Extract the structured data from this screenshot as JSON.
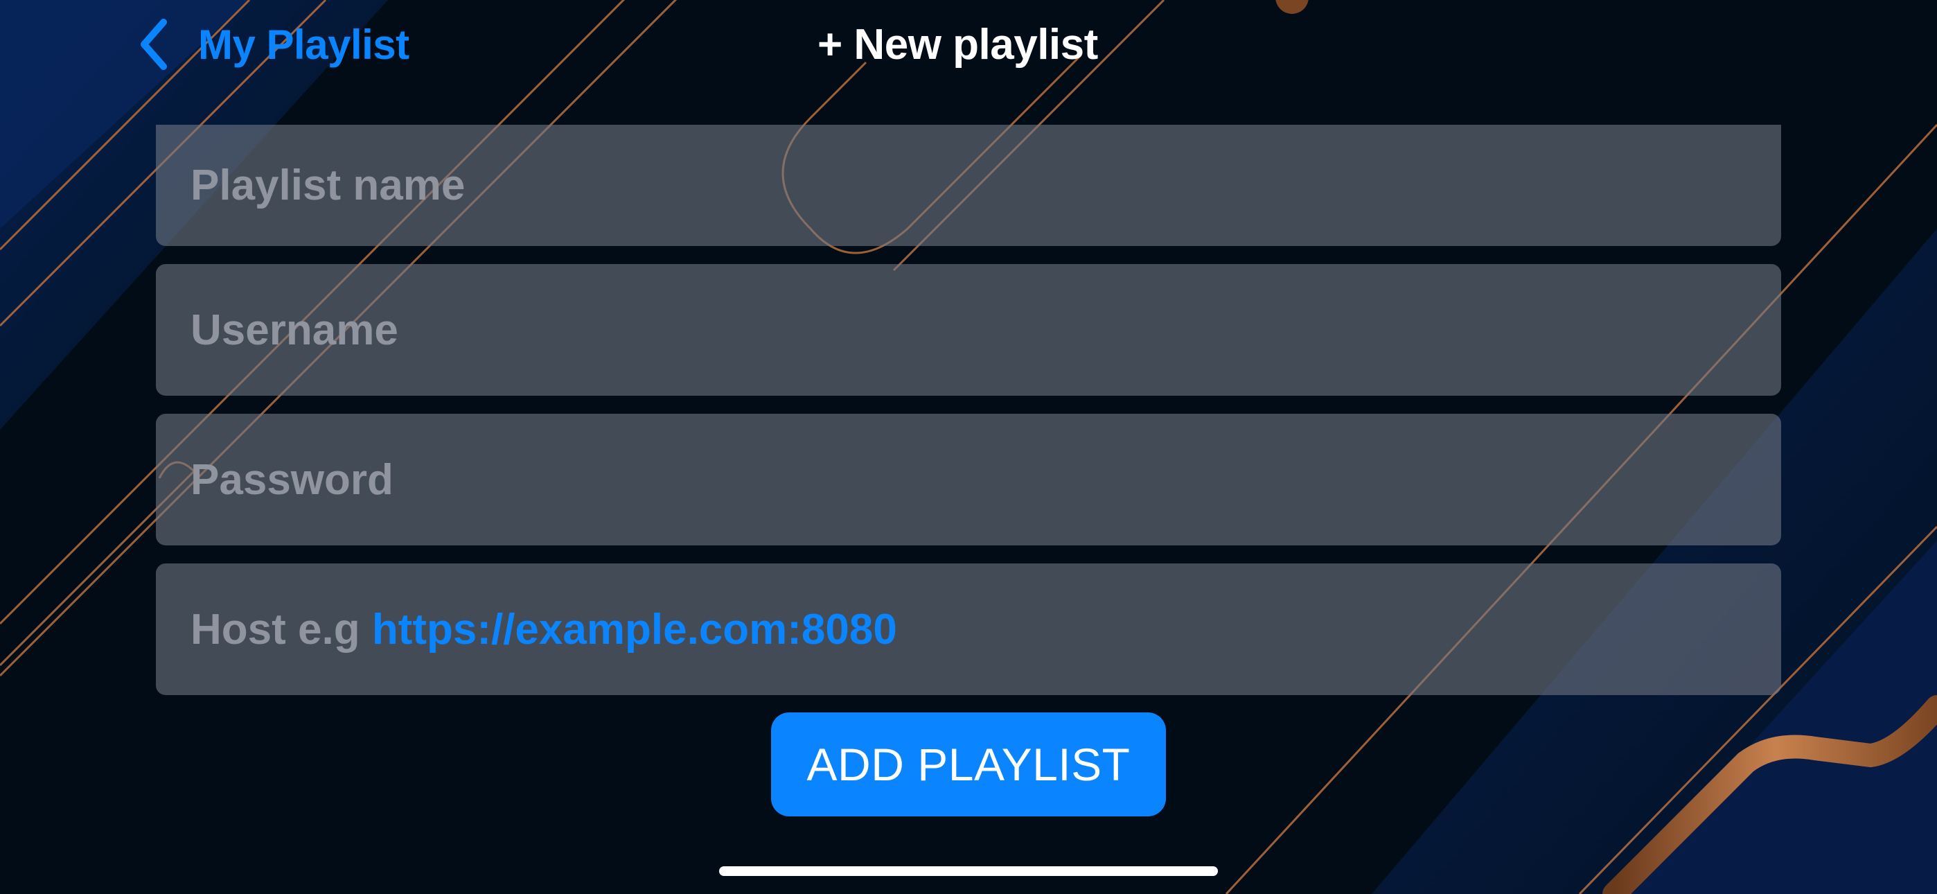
{
  "nav": {
    "back_label": "My Playlist",
    "back_icon": "chevron-left-icon",
    "title": "+ New playlist"
  },
  "form": {
    "playlist_name": {
      "value": "",
      "placeholder": "Playlist name"
    },
    "username": {
      "value": "",
      "placeholder": "Username"
    },
    "password": {
      "value": "",
      "placeholder": "Password"
    },
    "host": {
      "value": "",
      "placeholder_prefix": "Host e.g ",
      "placeholder_example": "https://example.com:8080"
    }
  },
  "actions": {
    "add_label": "ADD PLAYLIST"
  },
  "colors": {
    "accent": "#0a84ff",
    "background": "#010d18",
    "field_bg": "#737884",
    "placeholder": "#8f949f",
    "line_copper": "#c0784a"
  }
}
